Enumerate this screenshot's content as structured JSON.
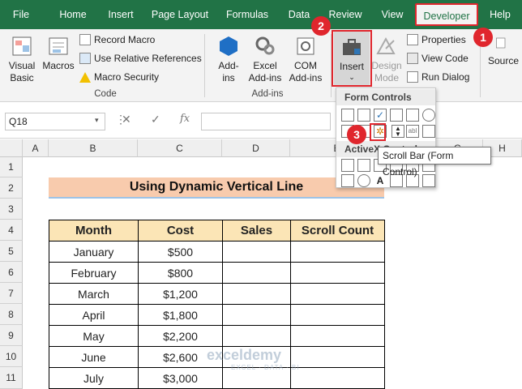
{
  "tabs": [
    "File",
    "Home",
    "Insert",
    "Page Layout",
    "Formulas",
    "Data",
    "Review",
    "View",
    "Developer",
    "Help"
  ],
  "ribbon": {
    "code": {
      "visual_basic_1": "Visual",
      "visual_basic_2": "Basic",
      "macros": "Macros",
      "record_macro": "Record Macro",
      "use_relative": "Use Relative References",
      "macro_security": "Macro Security",
      "label": "Code"
    },
    "addins": {
      "addins_1": "Add-",
      "addins_2": "ins",
      "excel_addins_1": "Excel",
      "excel_addins_2": "Add-ins",
      "com_addins_1": "COM",
      "com_addins_2": "Add-ins",
      "label": "Add-ins"
    },
    "controls": {
      "insert": "Insert",
      "design_1": "Design",
      "design_2": "Mode",
      "properties": "Properties",
      "view_code": "View Code",
      "run_dialog": "Run Dialog"
    },
    "xml": {
      "source": "Source"
    }
  },
  "formula_bar": {
    "name_box": "Q18",
    "cancel": "✕",
    "enter": "✓",
    "fx": "fx"
  },
  "columns": [
    "A",
    "B",
    "C",
    "D",
    "E",
    "F",
    "G",
    "H"
  ],
  "rows": [
    "1",
    "2",
    "3",
    "4",
    "5",
    "6",
    "7",
    "8",
    "9",
    "10",
    "11"
  ],
  "sheet": {
    "title": "Using Dynamic Vertical Line",
    "headers": [
      "Month",
      "Cost",
      "Sales",
      "Scroll Count"
    ],
    "data": [
      [
        "January",
        "$500",
        "",
        ""
      ],
      [
        "February",
        "$800",
        "",
        ""
      ],
      [
        "March",
        "$1,200",
        "",
        ""
      ],
      [
        "April",
        "$1,800",
        "",
        ""
      ],
      [
        "May",
        "$2,200",
        "",
        ""
      ],
      [
        "June",
        "$2,600",
        "",
        ""
      ],
      [
        "July",
        "$3,000",
        "",
        ""
      ]
    ]
  },
  "dropdown": {
    "form_controls": "Form Controls",
    "activex": "ActiveX Controls"
  },
  "tooltip": "Scroll Bar (Form Control)",
  "badges": [
    "1",
    "2",
    "3"
  ],
  "watermark": {
    "name": "exceldemy",
    "tagline": "EXCEL · DATA · BI"
  },
  "colors": {
    "accent": "#217346",
    "highlight": "#e0262d",
    "title_fill": "#f8cbad",
    "header_fill": "#fbe5b6"
  }
}
